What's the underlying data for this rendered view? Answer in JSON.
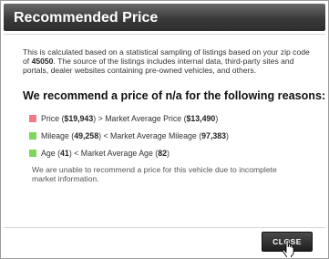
{
  "dialog": {
    "title": "Recommended Price",
    "description": {
      "text_before": "This is calculated based on a statistical sampling of listings based on your zip code of ",
      "zip": "45050",
      "text_after": ". The source of the listings includes internal data, third-party sites and portals, dealer websites containing pre-owned vehicles, and others."
    },
    "headline": "We recommend a price of n/a for the following reasons:",
    "reasons": [
      {
        "color": "#f07a86",
        "prefix": "Price (",
        "value": "$19,943",
        "middle": ") > Market Average Price (",
        "compare": "$13,490",
        "suffix": ")"
      },
      {
        "color": "#7ed65f",
        "prefix": "Mileage (",
        "value": "49,258",
        "middle": ") < Market Average Mileage (",
        "compare": "97,383",
        "suffix": ")"
      },
      {
        "color": "#7ed65f",
        "prefix": "Age (",
        "value": "41",
        "middle": ") < Market Average Age (",
        "compare": "82",
        "suffix": ")"
      }
    ],
    "note": "We are unable to recommend a price for this vehicle due to incomplete market information.",
    "close_label": "CLOSE"
  },
  "icons": {
    "cursor": "hand-pointer-icon"
  }
}
